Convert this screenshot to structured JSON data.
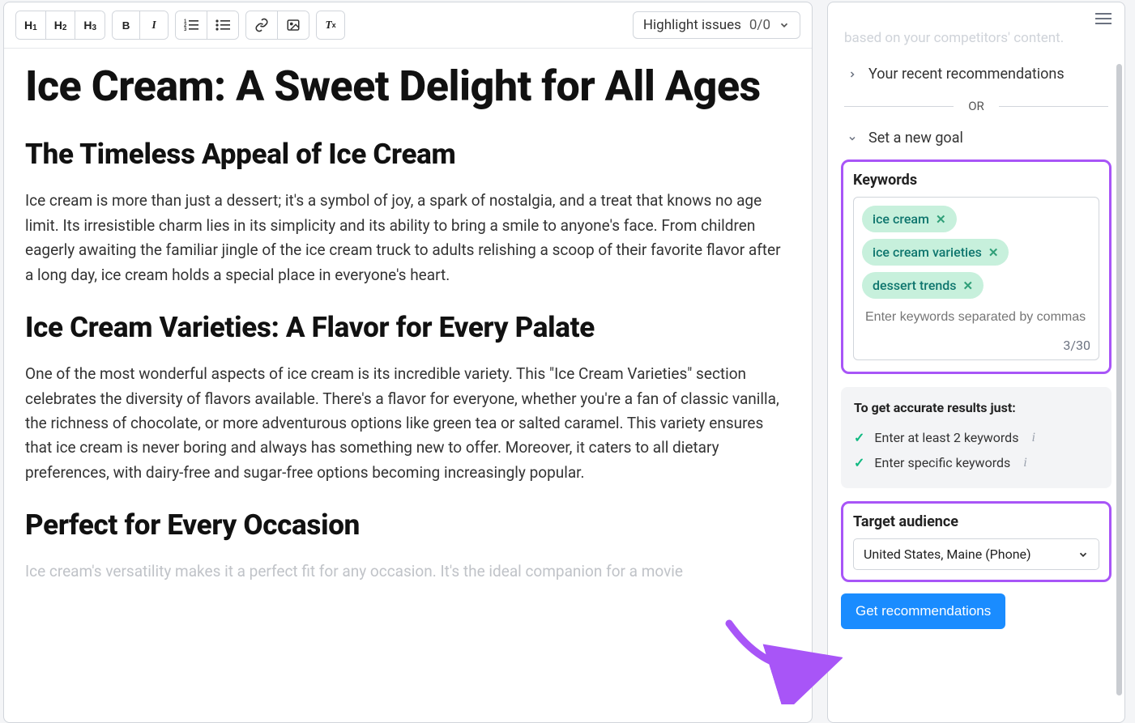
{
  "toolbar": {
    "highlight_label": "Highlight issues",
    "highlight_count": "0/0"
  },
  "document": {
    "title": "Ice Cream: A Sweet Delight for All Ages",
    "h2_1": "The Timeless Appeal of Ice Cream",
    "p1": "Ice cream is more than just a dessert; it's a symbol of joy, a spark of nostalgia, and a treat that knows no age limit. Its irresistible charm lies in its simplicity and its ability to bring a smile to anyone's face. From children eagerly awaiting the familiar jingle of the ice cream truck to adults relishing a scoop of their favorite flavor after a long day, ice cream holds a special place in everyone's heart.",
    "h2_2": "Ice Cream Varieties: A Flavor for Every Palate",
    "p2": "One of the most wonderful aspects of ice cream is its incredible variety. This \"Ice Cream Varieties\" section celebrates the diversity of flavors available. There's a flavor for everyone, whether you're a fan of classic vanilla, the richness of chocolate, or more adventurous options like green tea or salted caramel. This variety ensures that ice cream is never boring and always has something new to offer. Moreover, it caters to all dietary preferences, with dairy-free and sugar-free options becoming increasingly popular.",
    "h2_3": "Perfect for Every Occasion",
    "p3": "Ice cream's versatility makes it a perfect fit for any occasion. It's the ideal companion for a movie"
  },
  "sidebar": {
    "faded_hint": "based on your competitors' content.",
    "recent_label": "Your recent recommendations",
    "or_label": "OR",
    "set_goal_label": "Set a new goal",
    "keywords": {
      "title": "Keywords",
      "chips": [
        "ice cream",
        "ice cream varieties",
        "dessert trends"
      ],
      "placeholder": "Enter keywords separated by commas",
      "counter": "3/30"
    },
    "info": {
      "title": "To get accurate results just:",
      "items": [
        "Enter at least 2 keywords",
        "Enter specific keywords"
      ]
    },
    "target": {
      "title": "Target audience",
      "value": "United States, Maine (Phone)"
    },
    "get_btn": "Get recommendations"
  }
}
